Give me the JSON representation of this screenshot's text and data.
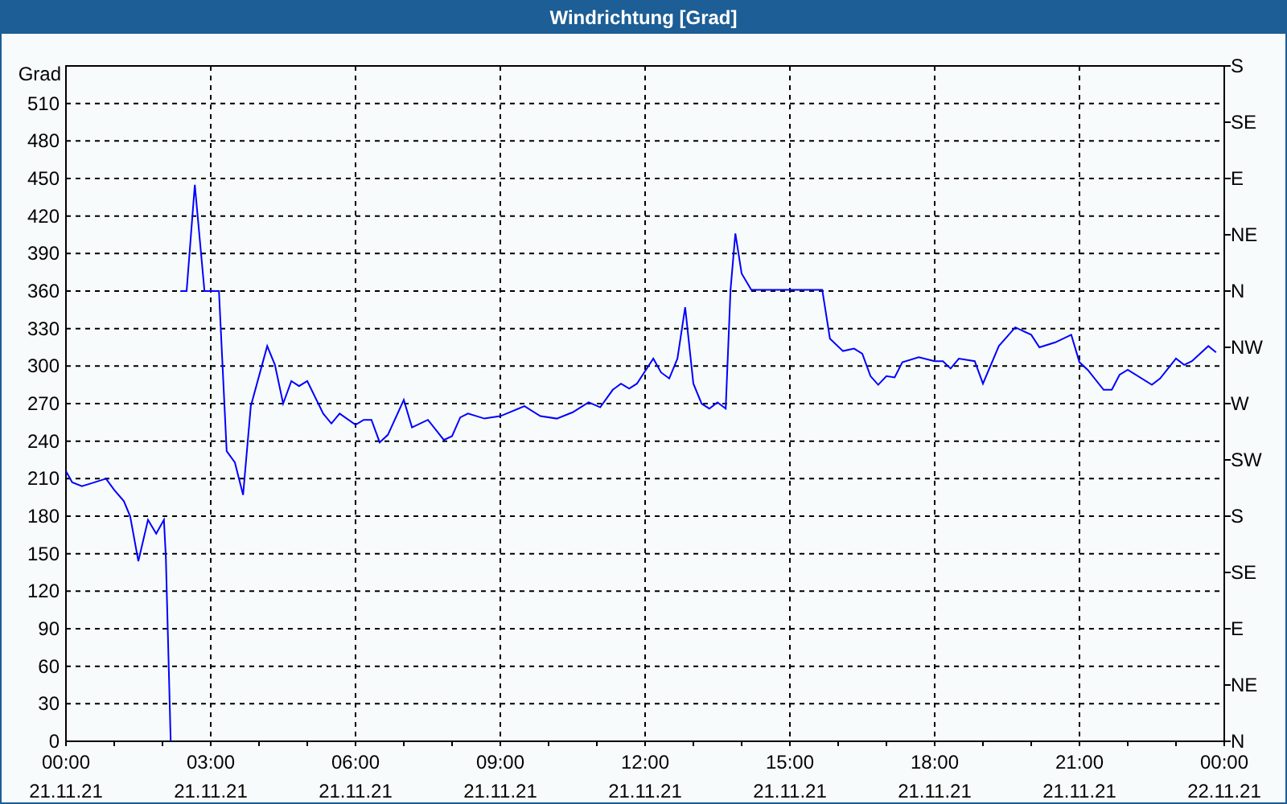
{
  "window": {
    "title": "Windrichtung [Grad]"
  },
  "chart_data": {
    "type": "line",
    "ylabel": "Grad",
    "x": [
      0,
      0.13,
      0.33,
      0.5,
      0.83,
      1.0,
      1.2,
      1.33,
      1.5,
      1.7,
      1.87,
      2.03,
      2.07,
      2.17,
      2.27,
      2.37,
      2.5,
      2.67,
      2.87,
      3.17,
      3.33,
      3.5,
      3.67,
      3.83,
      4.17,
      4.33,
      4.5,
      4.67,
      4.83,
      5.0,
      5.33,
      5.5,
      5.67,
      6.0,
      6.17,
      6.33,
      6.5,
      6.67,
      7.0,
      7.17,
      7.5,
      7.83,
      8.0,
      8.17,
      8.33,
      8.67,
      9.0,
      9.5,
      9.83,
      10.17,
      10.5,
      10.83,
      11.07,
      11.33,
      11.5,
      11.67,
      11.83,
      12.17,
      12.33,
      12.5,
      12.67,
      12.83,
      13.0,
      13.17,
      13.33,
      13.5,
      13.67,
      13.77,
      13.87,
      14.0,
      14.2,
      15.67,
      15.83,
      16.1,
      16.33,
      16.5,
      16.67,
      16.83,
      17.0,
      17.17,
      17.33,
      17.67,
      18.0,
      18.17,
      18.33,
      18.5,
      18.83,
      19.0,
      19.33,
      19.67,
      20.0,
      20.17,
      20.5,
      20.83,
      21.0,
      21.17,
      21.5,
      21.67,
      21.83,
      22.0,
      22.5,
      22.67,
      23.0,
      23.17,
      23.33,
      23.67,
      23.83
    ],
    "series": [
      {
        "color": "#0000ff",
        "values": [
          216,
          207,
          204,
          206,
          210,
          201,
          192,
          180,
          144,
          177,
          166,
          177,
          147,
          0,
          null,
          360,
          360,
          445,
          360,
          360,
          232,
          223,
          197,
          268,
          316,
          301,
          270,
          288,
          284,
          288,
          262,
          254,
          262,
          253,
          257,
          257,
          239,
          245,
          273,
          251,
          257,
          241,
          244,
          259,
          262,
          258,
          260,
          268,
          260,
          258,
          263,
          271,
          267,
          281,
          286,
          282,
          286,
          306,
          295,
          290,
          306,
          347,
          286,
          270,
          266,
          271,
          266,
          361,
          406,
          374,
          361,
          361,
          322,
          312,
          314,
          310,
          292,
          285,
          292,
          291,
          303,
          307,
          304,
          304,
          298,
          306,
          304,
          286,
          316,
          331,
          325,
          315,
          319,
          325,
          303,
          297,
          281,
          281,
          293,
          297,
          285,
          290,
          306,
          301,
          304,
          316,
          311
        ]
      }
    ],
    "xlim": [
      0,
      24
    ],
    "ylim": [
      0,
      540
    ],
    "grid": true,
    "xticks": [
      {
        "value": 0,
        "label": "00:00"
      },
      {
        "value": 3,
        "label": "03:00"
      },
      {
        "value": 6,
        "label": "06:00"
      },
      {
        "value": 9,
        "label": "09:00"
      },
      {
        "value": 12,
        "label": "12:00"
      },
      {
        "value": 15,
        "label": "15:00"
      },
      {
        "value": 18,
        "label": "18:00"
      },
      {
        "value": 21,
        "label": "21:00"
      },
      {
        "value": 24,
        "label": "00:00"
      }
    ],
    "yticks": [
      0,
      30,
      60,
      90,
      120,
      150,
      180,
      210,
      240,
      270,
      300,
      330,
      360,
      390,
      420,
      450,
      480,
      510
    ]
  },
  "x_date_labels": [
    "21.11.21",
    "21.11.21",
    "21.11.21",
    "21.11.21",
    "21.11.21",
    "21.11.21",
    "21.11.21",
    "21.11.21",
    "22.11.21"
  ],
  "compass_axis": {
    "labels": [
      "S",
      "SE",
      "E",
      "NE",
      "N",
      "NW",
      "W",
      "SW",
      "S",
      "SE",
      "E",
      "NE",
      "N"
    ]
  }
}
